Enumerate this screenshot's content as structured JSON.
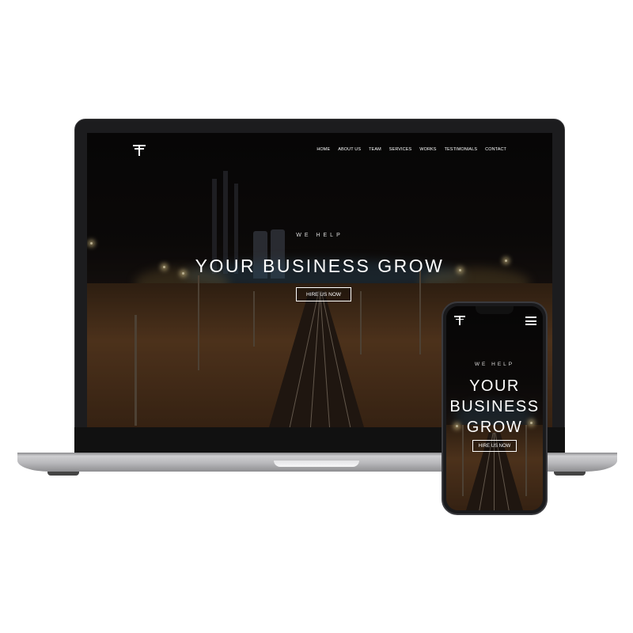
{
  "desktop_site": {
    "logo_icon": "tower-logo-icon",
    "nav": [
      "HOME",
      "ABOUT US",
      "TEAM",
      "SERVICES",
      "WORKS",
      "TESTIMONIALS",
      "CONTACT"
    ],
    "hero": {
      "tagline": "WE HELP",
      "headline": "YOUR BUSINESS GROW",
      "cta_label": "HIRE US NOW"
    }
  },
  "mobile_site": {
    "logo_icon": "tower-logo-icon",
    "menu_icon": "hamburger-menu-icon",
    "hero": {
      "tagline": "WE HELP",
      "headline_line1": "YOUR",
      "headline_line2": "BUSINESS",
      "headline_line3": "GROW",
      "cta_label": "HIRE US NOW"
    }
  },
  "colors": {
    "text": "#ffffff",
    "background": "#0c0a0a",
    "ground_accent": "#6a4526",
    "device_frame": "#1c1c1e"
  }
}
